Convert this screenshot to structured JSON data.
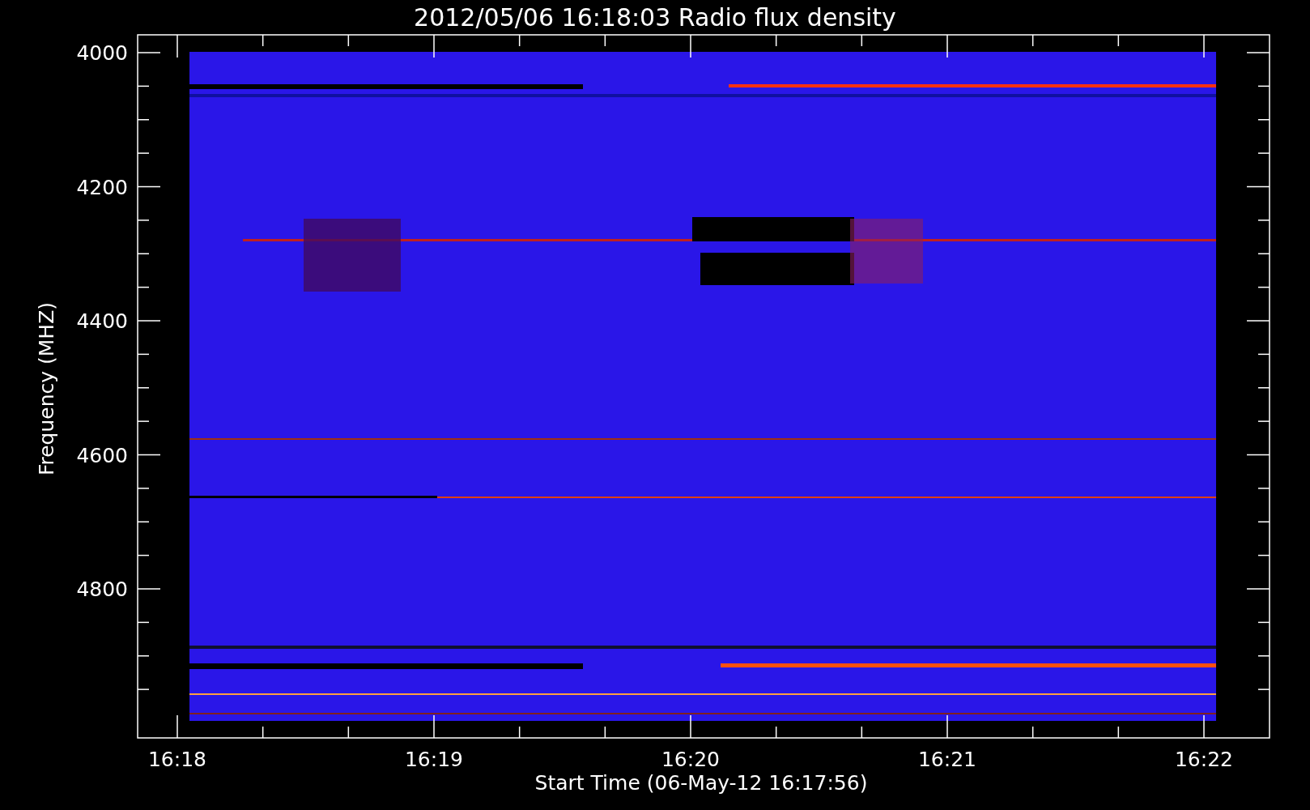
{
  "plot": {
    "title": "2012/05/06 16:18:03 Radio flux density",
    "ylabel": "Frequency (MHZ)",
    "xlabel": "Start Time (06-May-12 16:17:56)",
    "yticks": [
      "4000",
      "4200",
      "4400",
      "4600",
      "4800"
    ],
    "xticks": [
      "16:18",
      "16:19",
      "16:20",
      "16:21",
      "16:22"
    ]
  }
}
